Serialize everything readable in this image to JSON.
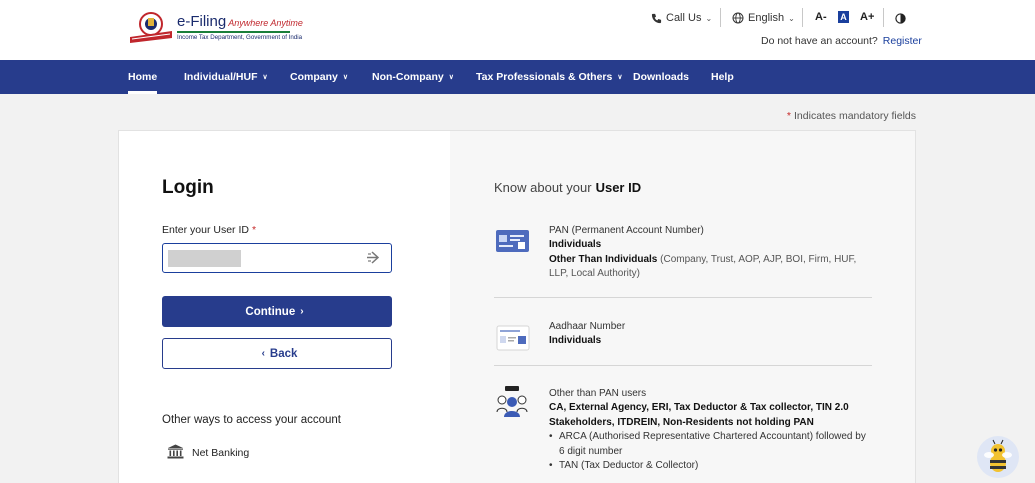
{
  "brand": {
    "name": "e-Filing",
    "tagline": "Anywhere Anytime",
    "subtitle": "Income Tax Department, Government of India"
  },
  "header": {
    "call_us": "Call Us",
    "language": "English",
    "font_decrease": "A-",
    "font_reset": "A",
    "font_increase": "A+",
    "no_account_text": "Do not have an account?",
    "register_label": "Register"
  },
  "nav": {
    "items": [
      {
        "label": "Home",
        "dropdown": false
      },
      {
        "label": "Individual/HUF",
        "dropdown": true
      },
      {
        "label": "Company",
        "dropdown": true
      },
      {
        "label": "Non-Company",
        "dropdown": true
      },
      {
        "label": "Tax Professionals & Others",
        "dropdown": true
      },
      {
        "label": "Downloads",
        "dropdown": false
      },
      {
        "label": "Help",
        "dropdown": false
      }
    ]
  },
  "mandatory_note": {
    "star": "*",
    "text": "Indicates mandatory fields"
  },
  "login": {
    "title": "Login",
    "userid_label": "Enter your User ID",
    "required_star": "*",
    "userid_value": "",
    "continue_label": "Continue",
    "back_label": "Back",
    "other_ways_title": "Other ways to access your account",
    "net_banking_label": "Net Banking"
  },
  "know": {
    "title_prefix": "Know about your",
    "title_bold": "User ID",
    "pan": {
      "heading": "PAN (Permanent Account Number)",
      "line1": "Individuals",
      "line2_bold": "Other Than Individuals",
      "line2_rest": "(Company, Trust, AOP, AJP, BOI, Firm, HUF, LLP, Local Authority)"
    },
    "aadhaar": {
      "heading": "Aadhaar Number",
      "line1": "Individuals"
    },
    "other": {
      "heading": "Other than PAN users",
      "line1": "CA, External Agency, ERI, Tax Deductor & Tax collector, TIN 2.0 Stakeholders, ITDREIN, Non-Residents not holding PAN",
      "bullets": [
        "ARCA (Authorised Representative Chartered Accountant) followed by 6 digit number",
        "TAN (Tax Deductor & Collector)"
      ]
    }
  },
  "colors": {
    "nav_bg": "#273c8c",
    "accent": "#1a3f9d",
    "required": "#c62828"
  },
  "icons": [
    "emblem-logo",
    "phone-icon",
    "globe-icon",
    "chevron-down-icon",
    "contrast-icon",
    "arrow-login-icon",
    "chevron-right-icon",
    "chevron-left-icon",
    "bank-icon",
    "pan-card-icon",
    "aadhaar-card-icon",
    "user-group-icon",
    "chatbot-mascot-icon"
  ]
}
